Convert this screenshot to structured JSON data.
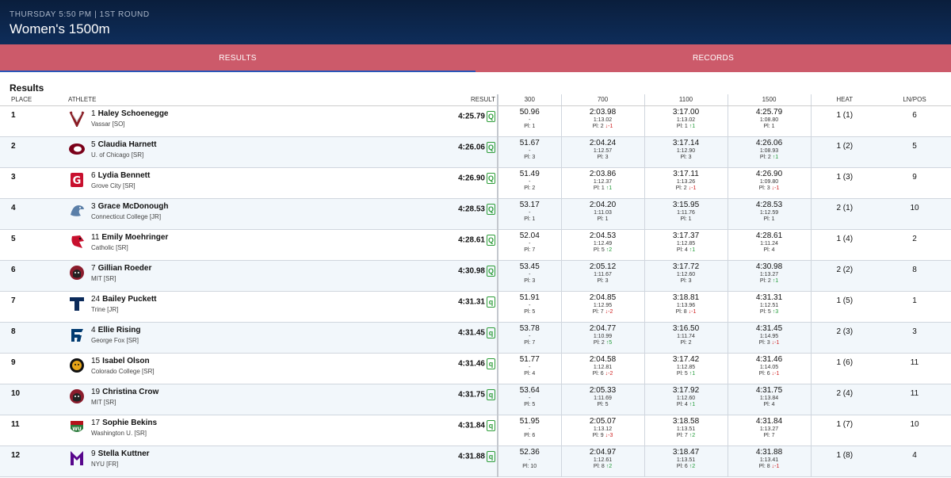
{
  "header": {
    "subtitle": "THURSDAY 5:50 PM | 1ST ROUND",
    "title": "Women's 1500m"
  },
  "tabs": [
    {
      "label": "RESULTS",
      "active": true
    },
    {
      "label": "RECORDS",
      "active": false
    }
  ],
  "section_title": "Results",
  "columns": {
    "place": "PLACE",
    "athlete": "ATHLETE",
    "result": "RESULT",
    "s300": "300",
    "s700": "700",
    "s1100": "1100",
    "s1500": "1500",
    "heat": "HEAT",
    "lnpos": "LN/POS"
  },
  "colors": {
    "header": "#0e2d5a",
    "tabs": "#cc5a6a",
    "qualify": "#2e9d3a",
    "up": "#1e9a35",
    "down": "#d02020"
  },
  "rows": [
    {
      "place": "1",
      "bib": "1",
      "name": "Haley Schoenegge",
      "team": "Vassar [SO]",
      "logo": "vassar-logo",
      "result": "4:25.79",
      "q": "Q",
      "s300": {
        "t": "50.96",
        "s": "-",
        "p": "Pl: 1"
      },
      "s700": {
        "t": "2:03.98",
        "s": "1:13.02",
        "p": "Pl: 2",
        "a": "↓-1",
        "d": "down"
      },
      "s1100": {
        "t": "3:17.00",
        "s": "1:13.02",
        "p": "Pl: 1",
        "a": "↑1",
        "d": "up"
      },
      "s1500": {
        "t": "4:25.79",
        "s": "1:08.80",
        "p": "Pl: 1"
      },
      "heat": "1 (1)",
      "lnpos": "6"
    },
    {
      "place": "2",
      "bib": "5",
      "name": "Claudia Harnett",
      "team": "U. of Chicago [SR]",
      "logo": "chicago-logo",
      "result": "4:26.06",
      "q": "Q",
      "s300": {
        "t": "51.67",
        "s": "-",
        "p": "Pl: 3"
      },
      "s700": {
        "t": "2:04.24",
        "s": "1:12.57",
        "p": "Pl: 3"
      },
      "s1100": {
        "t": "3:17.14",
        "s": "1:12.90",
        "p": "Pl: 3"
      },
      "s1500": {
        "t": "4:26.06",
        "s": "1:08.93",
        "p": "Pl: 2",
        "a": "↑1",
        "d": "up"
      },
      "heat": "1 (2)",
      "lnpos": "5"
    },
    {
      "place": "3",
      "bib": "6",
      "name": "Lydia Bennett",
      "team": "Grove City [SR]",
      "logo": "grove-city-logo",
      "result": "4:26.90",
      "q": "Q",
      "s300": {
        "t": "51.49",
        "s": "-",
        "p": "Pl: 2"
      },
      "s700": {
        "t": "2:03.86",
        "s": "1:12.37",
        "p": "Pl: 1",
        "a": "↑1",
        "d": "up"
      },
      "s1100": {
        "t": "3:17.11",
        "s": "1:13.26",
        "p": "Pl: 2",
        "a": "↓-1",
        "d": "down"
      },
      "s1500": {
        "t": "4:26.90",
        "s": "1:09.80",
        "p": "Pl: 3",
        "a": "↓-1",
        "d": "down"
      },
      "heat": "1 (3)",
      "lnpos": "9"
    },
    {
      "place": "4",
      "bib": "3",
      "name": "Grace McDonough",
      "team": "Connecticut College [JR]",
      "logo": "connecticut-college-logo",
      "result": "4:28.53",
      "q": "Q",
      "s300": {
        "t": "53.17",
        "s": "-",
        "p": "Pl: 1"
      },
      "s700": {
        "t": "2:04.20",
        "s": "1:11.03",
        "p": "Pl: 1"
      },
      "s1100": {
        "t": "3:15.95",
        "s": "1:11.76",
        "p": "Pl: 1"
      },
      "s1500": {
        "t": "4:28.53",
        "s": "1:12.59",
        "p": "Pl: 1"
      },
      "heat": "2 (1)",
      "lnpos": "10"
    },
    {
      "place": "5",
      "bib": "11",
      "name": "Emily Moehringer",
      "team": "Catholic [SR]",
      "logo": "catholic-logo",
      "result": "4:28.61",
      "q": "Q",
      "s300": {
        "t": "52.04",
        "s": "-",
        "p": "Pl: 7"
      },
      "s700": {
        "t": "2:04.53",
        "s": "1:12.49",
        "p": "Pl: 5",
        "a": "↑2",
        "d": "up"
      },
      "s1100": {
        "t": "3:17.37",
        "s": "1:12.85",
        "p": "Pl: 4",
        "a": "↑1",
        "d": "up"
      },
      "s1500": {
        "t": "4:28.61",
        "s": "1:11.24",
        "p": "Pl: 4"
      },
      "heat": "1 (4)",
      "lnpos": "2"
    },
    {
      "place": "6",
      "bib": "7",
      "name": "Gillian Roeder",
      "team": "MIT [SR]",
      "logo": "mit-logo",
      "result": "4:30.98",
      "q": "Q",
      "s300": {
        "t": "53.45",
        "s": "-",
        "p": "Pl: 3"
      },
      "s700": {
        "t": "2:05.12",
        "s": "1:11.67",
        "p": "Pl: 3"
      },
      "s1100": {
        "t": "3:17.72",
        "s": "1:12.60",
        "p": "Pl: 3"
      },
      "s1500": {
        "t": "4:30.98",
        "s": "1:13.27",
        "p": "Pl: 2",
        "a": "↑1",
        "d": "up"
      },
      "heat": "2 (2)",
      "lnpos": "8"
    },
    {
      "place": "7",
      "bib": "24",
      "name": "Bailey Puckett",
      "team": "Trine [JR]",
      "logo": "trine-logo",
      "result": "4:31.31",
      "q": "q",
      "s300": {
        "t": "51.91",
        "s": "-",
        "p": "Pl: 5"
      },
      "s700": {
        "t": "2:04.85",
        "s": "1:12.95",
        "p": "Pl: 7",
        "a": "↓-2",
        "d": "down"
      },
      "s1100": {
        "t": "3:18.81",
        "s": "1:13.96",
        "p": "Pl: 8",
        "a": "↓-1",
        "d": "down"
      },
      "s1500": {
        "t": "4:31.31",
        "s": "1:12.51",
        "p": "Pl: 5",
        "a": "↑3",
        "d": "up"
      },
      "heat": "1 (5)",
      "lnpos": "1"
    },
    {
      "place": "8",
      "bib": "4",
      "name": "Ellie Rising",
      "team": "George Fox [SR]",
      "logo": "george-fox-logo",
      "result": "4:31.45",
      "q": "q",
      "s300": {
        "t": "53.78",
        "s": "-",
        "p": "Pl: 7"
      },
      "s700": {
        "t": "2:04.77",
        "s": "1:10.99",
        "p": "Pl: 2",
        "a": "↑5",
        "d": "up"
      },
      "s1100": {
        "t": "3:16.50",
        "s": "1:11.74",
        "p": "Pl: 2"
      },
      "s1500": {
        "t": "4:31.45",
        "s": "1:14.95",
        "p": "Pl: 3",
        "a": "↓-1",
        "d": "down"
      },
      "heat": "2 (3)",
      "lnpos": "3"
    },
    {
      "place": "9",
      "bib": "15",
      "name": "Isabel Olson",
      "team": "Colorado College [SR]",
      "logo": "colorado-college-logo",
      "result": "4:31.46",
      "q": "q",
      "s300": {
        "t": "51.77",
        "s": "-",
        "p": "Pl: 4"
      },
      "s700": {
        "t": "2:04.58",
        "s": "1:12.81",
        "p": "Pl: 6",
        "a": "↓-2",
        "d": "down"
      },
      "s1100": {
        "t": "3:17.42",
        "s": "1:12.85",
        "p": "Pl: 5",
        "a": "↑1",
        "d": "up"
      },
      "s1500": {
        "t": "4:31.46",
        "s": "1:14.05",
        "p": "Pl: 6",
        "a": "↓-1",
        "d": "down"
      },
      "heat": "1 (6)",
      "lnpos": "11"
    },
    {
      "place": "10",
      "bib": "19",
      "name": "Christina Crow",
      "team": "MIT [SR]",
      "logo": "mit-logo",
      "result": "4:31.75",
      "q": "q",
      "s300": {
        "t": "53.64",
        "s": "-",
        "p": "Pl: 5"
      },
      "s700": {
        "t": "2:05.33",
        "s": "1:11.69",
        "p": "Pl: 5"
      },
      "s1100": {
        "t": "3:17.92",
        "s": "1:12.60",
        "p": "Pl: 4",
        "a": "↑1",
        "d": "up"
      },
      "s1500": {
        "t": "4:31.75",
        "s": "1:13.84",
        "p": "Pl: 4"
      },
      "heat": "2 (4)",
      "lnpos": "11"
    },
    {
      "place": "11",
      "bib": "17",
      "name": "Sophie Bekins",
      "team": "Washington U. [SR]",
      "logo": "washington-u-logo",
      "result": "4:31.84",
      "q": "q",
      "s300": {
        "t": "51.95",
        "s": "-",
        "p": "Pl: 6"
      },
      "s700": {
        "t": "2:05.07",
        "s": "1:13.12",
        "p": "Pl: 9",
        "a": "↓-3",
        "d": "down"
      },
      "s1100": {
        "t": "3:18.58",
        "s": "1:13.51",
        "p": "Pl: 7",
        "a": "↑2",
        "d": "up"
      },
      "s1500": {
        "t": "4:31.84",
        "s": "1:13.27",
        "p": "Pl: 7"
      },
      "heat": "1 (7)",
      "lnpos": "10"
    },
    {
      "place": "12",
      "bib": "9",
      "name": "Stella Kuttner",
      "team": "NYU [FR]",
      "logo": "nyu-logo",
      "result": "4:31.88",
      "q": "q",
      "s300": {
        "t": "52.36",
        "s": "-",
        "p": "Pl: 10"
      },
      "s700": {
        "t": "2:04.97",
        "s": "1:12.61",
        "p": "Pl: 8",
        "a": "↑2",
        "d": "up"
      },
      "s1100": {
        "t": "3:18.47",
        "s": "1:13.51",
        "p": "Pl: 6",
        "a": "↑2",
        "d": "up"
      },
      "s1500": {
        "t": "4:31.88",
        "s": "1:13.41",
        "p": "Pl: 8",
        "a": "↓-1",
        "d": "down"
      },
      "heat": "1 (8)",
      "lnpos": "4"
    }
  ]
}
